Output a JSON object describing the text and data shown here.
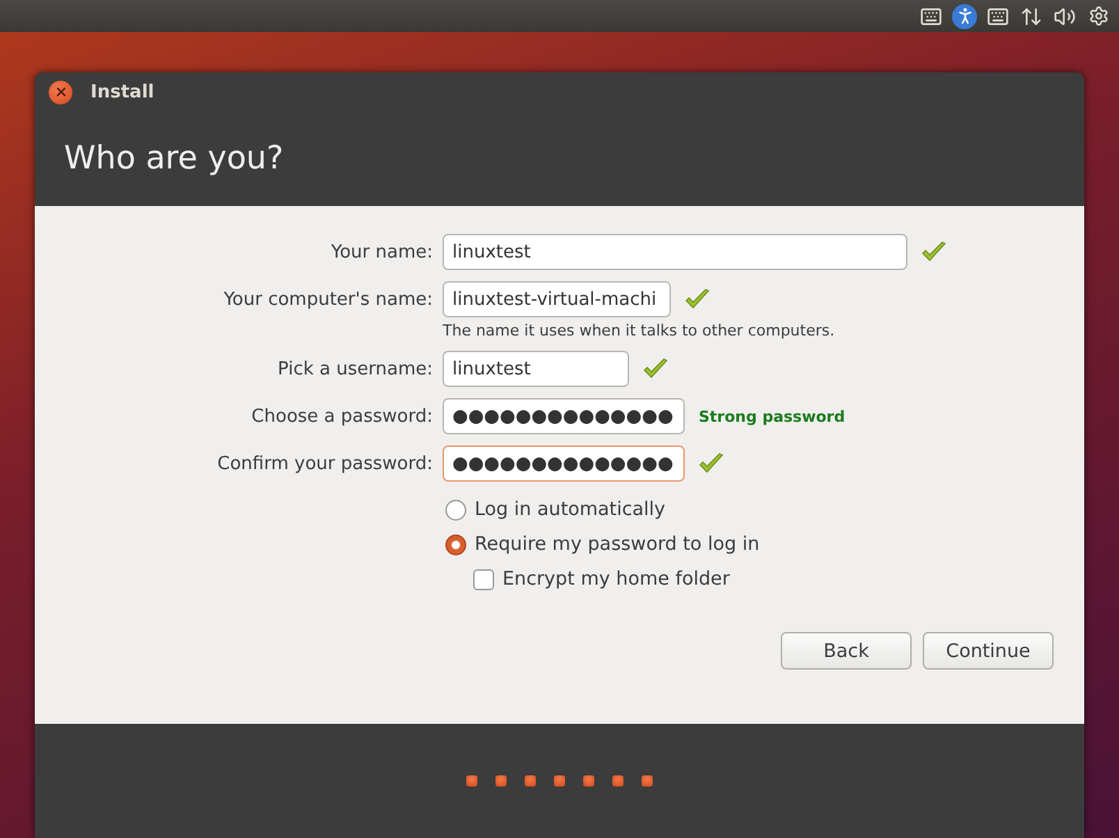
{
  "window": {
    "title": "Install",
    "heading": "Who are you?"
  },
  "fields": [
    {
      "label": "Your name:",
      "value": "linuxtest",
      "valid": true,
      "focused": false
    },
    {
      "label": "Your computer's name:",
      "value": "linuxtest-virtual-machi",
      "valid": true,
      "focused": false,
      "hint": "The name it uses when it talks to other computers."
    },
    {
      "label": "Pick a username:",
      "value": "linuxtest",
      "valid": true,
      "focused": false
    },
    {
      "label": "Choose a password:",
      "value": "●●●●●●●●●●●●●●",
      "valid": false,
      "focused": false,
      "strength": "Strong password"
    },
    {
      "label": "Confirm your password:",
      "value": "●●●●●●●●●●●●●●",
      "valid": true,
      "focused": true
    }
  ],
  "login_options": [
    {
      "kind": "radio",
      "label": "Log in automatically",
      "selected": false
    },
    {
      "kind": "radio",
      "label": "Require my password to log in",
      "selected": true
    },
    {
      "kind": "checkbox",
      "label": "Encrypt my home folder",
      "checked": false
    }
  ],
  "buttons": [
    "Back",
    "Continue"
  ]
}
